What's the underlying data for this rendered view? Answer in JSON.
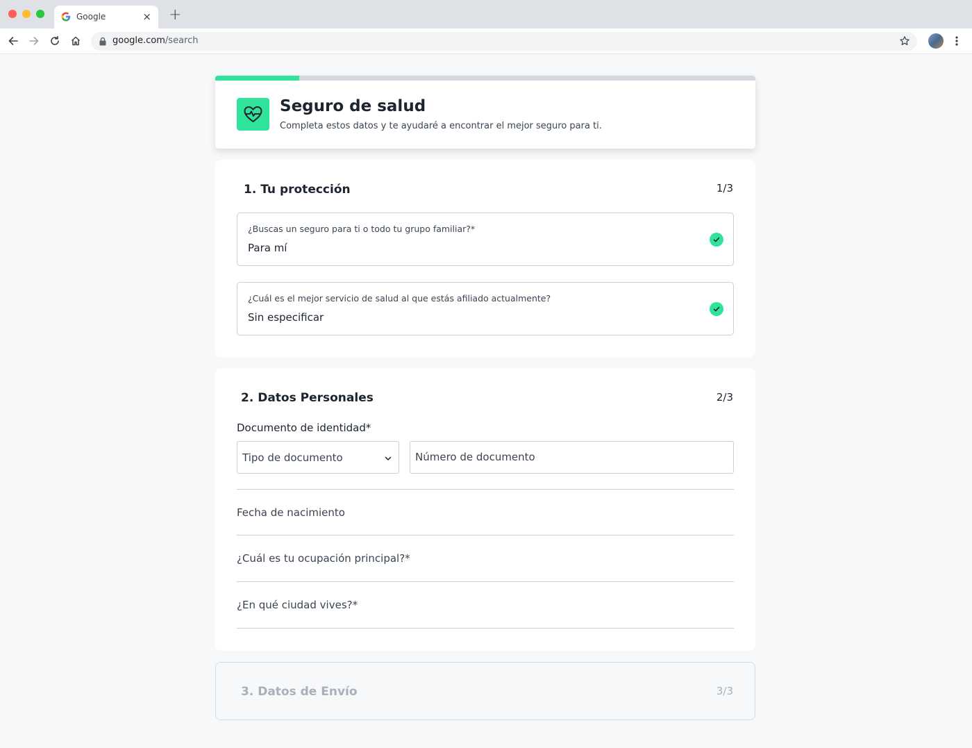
{
  "browser": {
    "tab_title": "Google",
    "tab_close": "×",
    "new_tab": "+",
    "url_host": "google.com",
    "url_path": "/search"
  },
  "header": {
    "title": "Seguro de salud",
    "subtitle": "Completa estos datos y te ayudaré a encontrar el mejor seguro para ti.",
    "progress_fraction": 0.155,
    "logo_icon": "heart-pulse-icon",
    "accent_color": "#2fe49a"
  },
  "sections": [
    {
      "title": "1. Tu protección",
      "step": "1/3",
      "questions": [
        {
          "label": "¿Buscas un seguro para ti o todo tu grupo familiar?*",
          "value": "Para mí",
          "status_icon": "check-icon"
        },
        {
          "label": "¿Cuál es el mejor servicio de salud al que estás afiliado actualmente?",
          "value": "Sin especificar",
          "status_icon": "check-icon"
        }
      ]
    },
    {
      "title": "2. Datos Personales",
      "step": "2/3",
      "document_label": "Documento de identidad*",
      "document_type_placeholder": "Tipo de documento",
      "document_number_placeholder": "Número de documento",
      "fields": [
        "Fecha de nacimiento",
        "¿Cuál es tu ocupación principal?*",
        "¿En qué ciudad vives?*"
      ]
    },
    {
      "title": "3. Datos de Envío",
      "step": "3/3"
    }
  ]
}
